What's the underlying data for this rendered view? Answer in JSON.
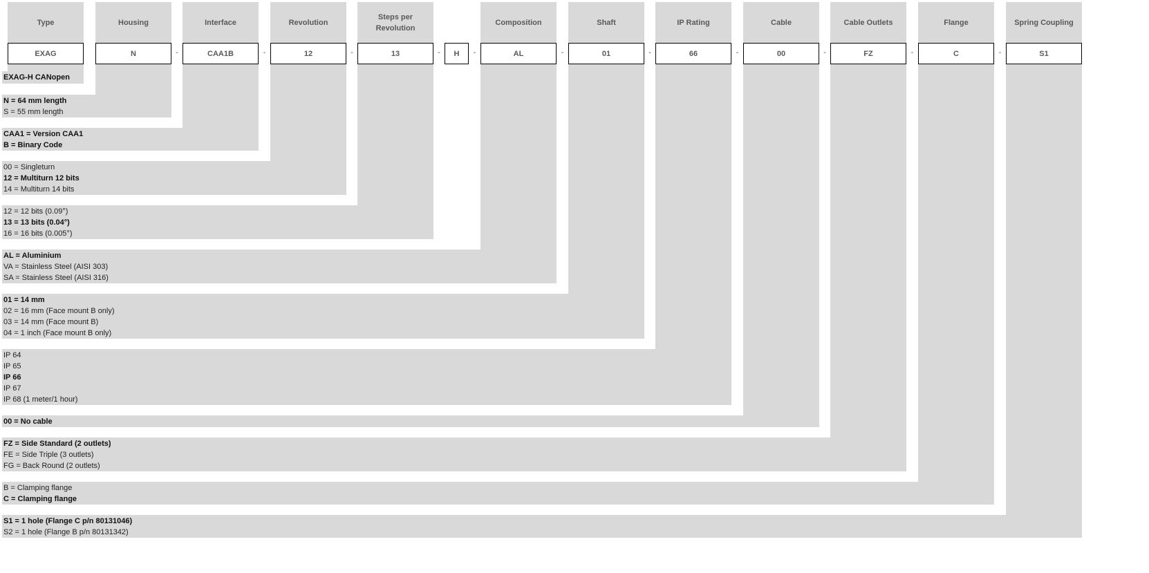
{
  "fields": [
    {
      "header": "Type",
      "code": "EXAG",
      "options": [
        {
          "text": "EXAG-H CANopen",
          "selected": true
        }
      ]
    },
    {
      "header": "Housing",
      "code": "N",
      "options": [
        {
          "text": "N = 64 mm length",
          "selected": true
        },
        {
          "text": "S = 55 mm length",
          "selected": false
        }
      ]
    },
    {
      "header": "Interface",
      "code": "CAA1B",
      "options": [
        {
          "text": "CAA1 = Version CAA1",
          "selected": true
        },
        {
          "text": "B = Binary Code",
          "selected": true
        }
      ]
    },
    {
      "header": "Revolution",
      "code": "12",
      "options": [
        {
          "text": "00 = Singleturn",
          "selected": false
        },
        {
          "text": "12 = Multiturn 12 bits",
          "selected": true
        },
        {
          "text": "14 = Multiturn 14 bits",
          "selected": false
        }
      ]
    },
    {
      "header": "Steps per Revolution",
      "code": "13",
      "options": [
        {
          "text": "12 = 12 bits (0.09°)",
          "selected": false
        },
        {
          "text": "13 = 13 bits (0.04°)",
          "selected": true
        },
        {
          "text": "16 = 16 bits (0.005°)",
          "selected": false
        }
      ]
    },
    {
      "header": "",
      "code": "H",
      "options": []
    },
    {
      "header": "Composition",
      "code": "AL",
      "options": [
        {
          "text": "AL = Aluminium",
          "selected": true
        },
        {
          "text": "VA = Stainless Steel (AISI 303)",
          "selected": false
        },
        {
          "text": "SA = Stainless Steel (AISI 316)",
          "selected": false
        }
      ]
    },
    {
      "header": "Shaft",
      "code": "01",
      "options": [
        {
          "text": "01 = 14 mm",
          "selected": true
        },
        {
          "text": "02 = 16 mm (Face mount B only)",
          "selected": false
        },
        {
          "text": "03 = 14 mm (Face mount B)",
          "selected": false
        },
        {
          "text": "04 = 1 inch (Face mount B only)",
          "selected": false
        }
      ]
    },
    {
      "header": "IP Rating",
      "code": "66",
      "options": [
        {
          "text": "IP 64",
          "selected": false
        },
        {
          "text": "IP 65",
          "selected": false
        },
        {
          "text": "IP 66",
          "selected": true
        },
        {
          "text": "IP 67",
          "selected": false
        },
        {
          "text": "IP 68 (1 meter/1 hour)",
          "selected": false
        }
      ]
    },
    {
      "header": "Cable",
      "code": "00",
      "options": [
        {
          "text": "00 = No cable",
          "selected": true
        }
      ]
    },
    {
      "header": "Cable Outlets",
      "code": "FZ",
      "options": [
        {
          "text": "FZ = Side Standard (2 outlets)",
          "selected": true
        },
        {
          "text": "FE = Side Triple (3 outlets)",
          "selected": false
        },
        {
          "text": "FG = Back Round (2 outlets)",
          "selected": false
        }
      ]
    },
    {
      "header": "Flange",
      "code": "C",
      "options": [
        {
          "text": "B = Clamping flange",
          "selected": false
        },
        {
          "text": "C = Clamping flange",
          "selected": true
        }
      ]
    },
    {
      "header": "Spring Coupling",
      "code": "S1",
      "options": [
        {
          "text": "S1 = 1 hole (Flange C p/n 80131046)",
          "selected": true
        },
        {
          "text": "S2 = 1 hole (Flange B p/n 80131342)",
          "selected": false
        }
      ]
    }
  ],
  "separator": "-",
  "colors": {
    "panel": "#d9d9d9",
    "header_text": "#595959",
    "box_border": "#000000"
  }
}
